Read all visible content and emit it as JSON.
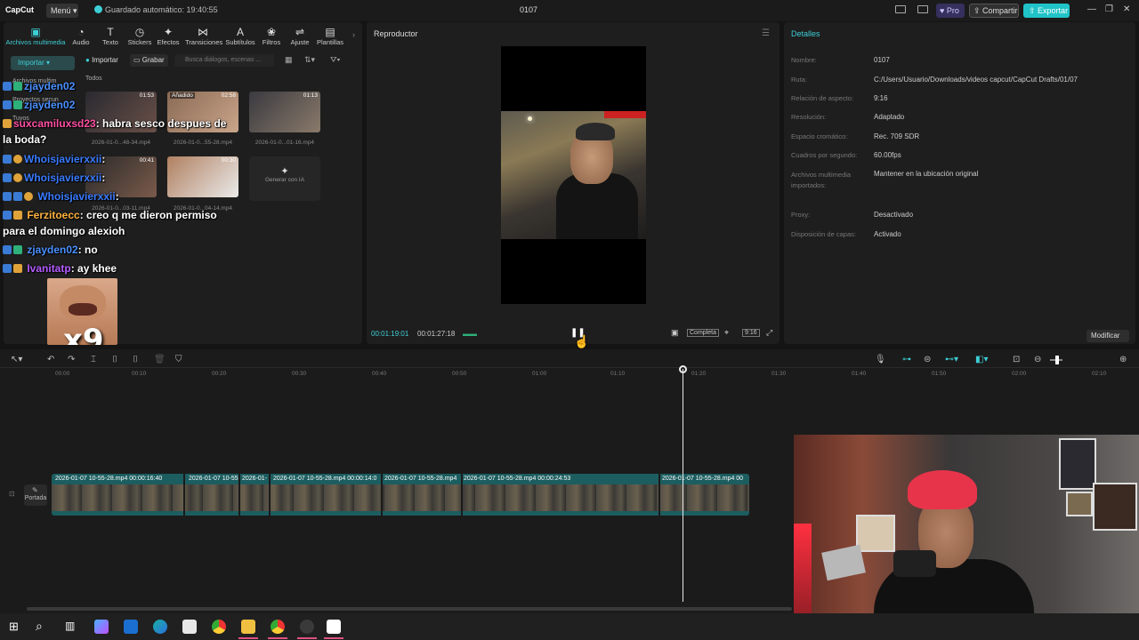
{
  "titlebar": {
    "app_logo": "CapCut",
    "menu": "Menú",
    "autosave": "Guardado automático: 19:40:55",
    "document": "0107",
    "pro": "Pro",
    "share": "Compartir",
    "export": "Exportar"
  },
  "media": {
    "tabs": [
      {
        "label": "Archivos multimedia",
        "icon": "media-icon"
      },
      {
        "label": "Audio",
        "icon": "audio-icon"
      },
      {
        "label": "Texto",
        "icon": "text-icon"
      },
      {
        "label": "Stickers",
        "icon": "sticker-icon"
      },
      {
        "label": "Efectos",
        "icon": "effects-icon"
      },
      {
        "label": "Transiciones",
        "icon": "transition-icon"
      },
      {
        "label": "Subtítulos",
        "icon": "subtitles-icon"
      },
      {
        "label": "Filtros",
        "icon": "filter-icon"
      },
      {
        "label": "Ajuste",
        "icon": "adjust-icon"
      },
      {
        "label": "Plantillas",
        "icon": "templates-icon"
      }
    ],
    "side_import": "Importar",
    "import_button": "Importar",
    "record_button": "Grabar",
    "search_placeholder": "Busca diálogos, escenas ...",
    "side_nav": [
      "Archivos multim",
      "Proyectos secun",
      "Tuyos"
    ],
    "filter_all": "Todos",
    "items": [
      {
        "name": "2026-01-0...48-34.mp4",
        "duration": "01:53",
        "added": ""
      },
      {
        "name": "2026-01-0...55-28.mp4",
        "duration": "02:58",
        "added": "Añadido"
      },
      {
        "name": "2026-01-0...01-16.mp4",
        "duration": "01:13",
        "added": ""
      },
      {
        "name": "2026-01-0...03-11.mp4",
        "duration": "00:41",
        "added": ""
      },
      {
        "name": "2026-01-0...04-14.mp4",
        "duration": "00:30",
        "added": ""
      }
    ],
    "generate_ai": "Generar con IA"
  },
  "chat": [
    {
      "user": "zjayden02",
      "message": "",
      "color": "#4a90ff"
    },
    {
      "user": "zjayden02",
      "message": "",
      "color": "#4a90ff"
    },
    {
      "user": "suxcamiluxsd23",
      "message": ": habra sesco despues de",
      "color": "#ff4fa3"
    },
    {
      "user": "",
      "message": "la boda?",
      "color": "#ffffff"
    },
    {
      "user": "Whoisjavierxxii",
      "message": ":",
      "color": "#3a7bff"
    },
    {
      "user": "Whoisjavierxxii",
      "message": ":",
      "color": "#3a7bff"
    },
    {
      "user": "Whoisjavierxxii",
      "message": ":",
      "color": "#3a7bff"
    },
    {
      "user": "Ferzitoecc",
      "message": ": creo q me dieron permiso",
      "color": "#ffb23f"
    },
    {
      "user": "",
      "message": "para el domingo alexioh",
      "color": "#ffffff"
    },
    {
      "user": "zjayden02",
      "message": ": no",
      "color": "#4a90ff"
    },
    {
      "user": "Ivanitatp",
      "message": ": ay khee",
      "color": "#b55cff"
    }
  ],
  "meme_text": "x9",
  "player": {
    "title": "Reproductor",
    "current_time": "00:01:19:01",
    "total_time": "00:01:27:18",
    "full_label": "Completa",
    "ratio_label": "9:16"
  },
  "details": {
    "title": "Detalles",
    "rows": [
      {
        "label": "Nombre:",
        "value": "0107"
      },
      {
        "label": "Ruta:",
        "value": "C:/Users/Usuario/Downloads/videos capcut/CapCut Drafts/01/07"
      },
      {
        "label": "Relación de aspecto:",
        "value": "9:16"
      },
      {
        "label": "Resolución:",
        "value": "Adaptado"
      },
      {
        "label": "Espacio cromático:",
        "value": "Rec. 709 SDR"
      },
      {
        "label": "Cuadros por segundo:",
        "value": "60.00fps"
      },
      {
        "label": "Archivos multimedia importados:",
        "value": "Mantener en la ubicación original"
      },
      {
        "label": "Proxy:",
        "value": "Desactivado"
      },
      {
        "label": "Disposición de capas:",
        "value": "Activado"
      }
    ],
    "modify": "Modificar"
  },
  "timeline": {
    "ruler": [
      "00:00",
      "00:10",
      "00:20",
      "00:30",
      "00:40",
      "00:50",
      "01:00",
      "01:10",
      "01:20",
      "01:30",
      "01:40",
      "01:50",
      "02:00",
      "02:10"
    ],
    "cover": "Portada",
    "clips": [
      {
        "label": "2026-01-07 10-55-28.mp4   00:00:16:40"
      },
      {
        "label": "2026-01-07 10-55"
      },
      {
        "label": "2026-01-"
      },
      {
        "label": "2026-01-07 10-55-28.mp4   00:00:14:0"
      },
      {
        "label": "2026-01-07 10-55-28.mp4"
      },
      {
        "label": "2026-01-07 10-55-28.mp4   00:00:24:53"
      },
      {
        "label": "2026-01-07 10-55-28.mp4   00"
      }
    ]
  },
  "colors": {
    "accent": "#3ecfd6",
    "export": "#20c3c8",
    "track": "#1c5d60"
  }
}
